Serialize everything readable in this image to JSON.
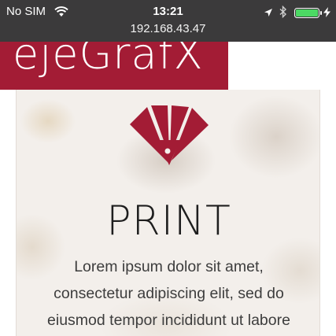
{
  "status_bar": {
    "carrier": "No SIM",
    "time": "13:21",
    "url": "192.168.43.47",
    "icons": [
      "wifi-icon",
      "location-arrow-icon",
      "bluetooth-icon",
      "battery-icon",
      "charging-bolt-icon"
    ],
    "battery_color": "#4cd964"
  },
  "brand": {
    "logo_text": "ejeGrafX",
    "color": "#a31c35"
  },
  "hero": {
    "icon": "swatch-fan-icon",
    "title": "PRINT",
    "body_lines": [
      "Lorem ipsum dolor sit amet,",
      "consectetur adipiscing elit, sed do",
      "eiusmod tempor incididunt ut labore"
    ]
  }
}
